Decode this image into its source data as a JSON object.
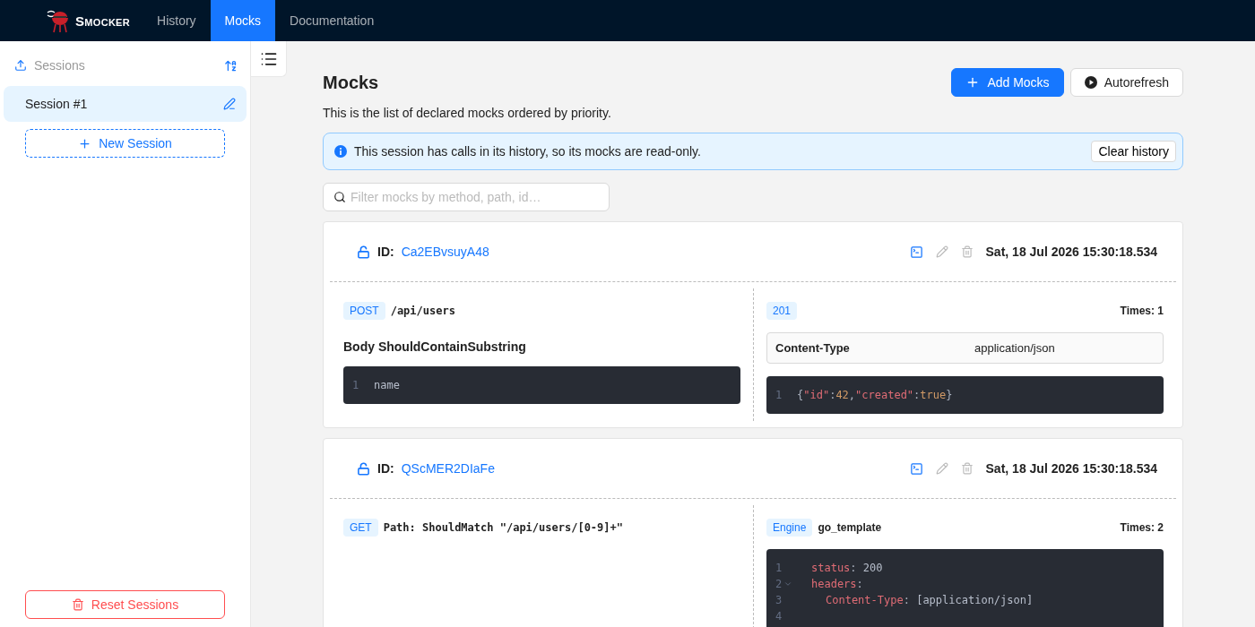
{
  "nav": {
    "brand": "SMOCKER",
    "tabs": [
      {
        "label": "History",
        "selected": false
      },
      {
        "label": "Mocks",
        "selected": true
      },
      {
        "label": "Documentation",
        "selected": false
      }
    ]
  },
  "sidebar": {
    "title": "Sessions",
    "sessions": [
      {
        "name": "Session #1",
        "selected": true
      }
    ],
    "new_session": "New Session",
    "reset": "Reset Sessions"
  },
  "main": {
    "title": "Mocks",
    "subtitle": "This is the list of declared mocks ordered by priority.",
    "buttons": [
      {
        "label": "Add Mocks",
        "kind": "primary"
      },
      {
        "label": "Autorefresh",
        "kind": "toggle"
      }
    ],
    "alert": {
      "message": "This session has calls in its history, so its mocks are read-only.",
      "action": "Clear history"
    },
    "filter": {
      "placeholder": "Filter mocks by method, path, id…"
    },
    "mocks": [
      {
        "locked": false,
        "id_label": "ID:",
        "id": "Ca2EBvsuyA48",
        "date": "Sat, 18 Jul 2026 15:30:18.534",
        "request": {
          "method": "POST",
          "path": "/api/users",
          "body_title": "Body ShouldContainSubstring",
          "body_code": [
            {
              "number": "1",
              "tokens": [
                {
                  "kind": "plain",
                  "text": "name"
                }
              ]
            }
          ]
        },
        "response": {
          "badge": "201",
          "times": "Times: 1",
          "headers": [
            {
              "name": "Content-Type",
              "value": "application/json"
            }
          ],
          "code": [
            {
              "number": "1",
              "tokens": [
                {
                  "kind": "punct",
                  "text": "{"
                },
                {
                  "kind": "key",
                  "text": "\"id\""
                },
                {
                  "kind": "punct",
                  "text": ":"
                },
                {
                  "kind": "number",
                  "text": "42"
                },
                {
                  "kind": "punct",
                  "text": ","
                },
                {
                  "kind": "key",
                  "text": "\"created\""
                },
                {
                  "kind": "punct",
                  "text": ":"
                },
                {
                  "kind": "number",
                  "text": "true"
                },
                {
                  "kind": "punct",
                  "text": "}"
                }
              ]
            }
          ]
        }
      },
      {
        "locked": false,
        "id_label": "ID:",
        "id": "QScMER2DIaFe",
        "date": "Sat, 18 Jul 2026 15:30:18.534",
        "request": {
          "method": "GET",
          "path": "Path: ShouldMatch \"/api/users/[0-9]+\""
        },
        "response": {
          "badge": "Engine",
          "badge_value": "go_template",
          "times": "Times: 2",
          "code": [
            {
              "number": "1",
              "tokens": [
                {
                  "kind": "key",
                  "text": "status"
                },
                {
                  "kind": "punct",
                  "text": ": "
                },
                {
                  "kind": "plain",
                  "text": "200"
                }
              ]
            },
            {
              "number": "2",
              "foldable": true,
              "tokens": [
                {
                  "kind": "key",
                  "text": "headers"
                },
                {
                  "kind": "punct",
                  "text": ":"
                }
              ]
            },
            {
              "number": "3",
              "indent": true,
              "tokens": [
                {
                  "kind": "key",
                  "text": "Content-Type"
                },
                {
                  "kind": "punct",
                  "text": ": "
                },
                {
                  "kind": "plain",
                  "text": "[application/json]"
                }
              ]
            },
            {
              "number": "4"
            }
          ]
        }
      }
    ]
  }
}
